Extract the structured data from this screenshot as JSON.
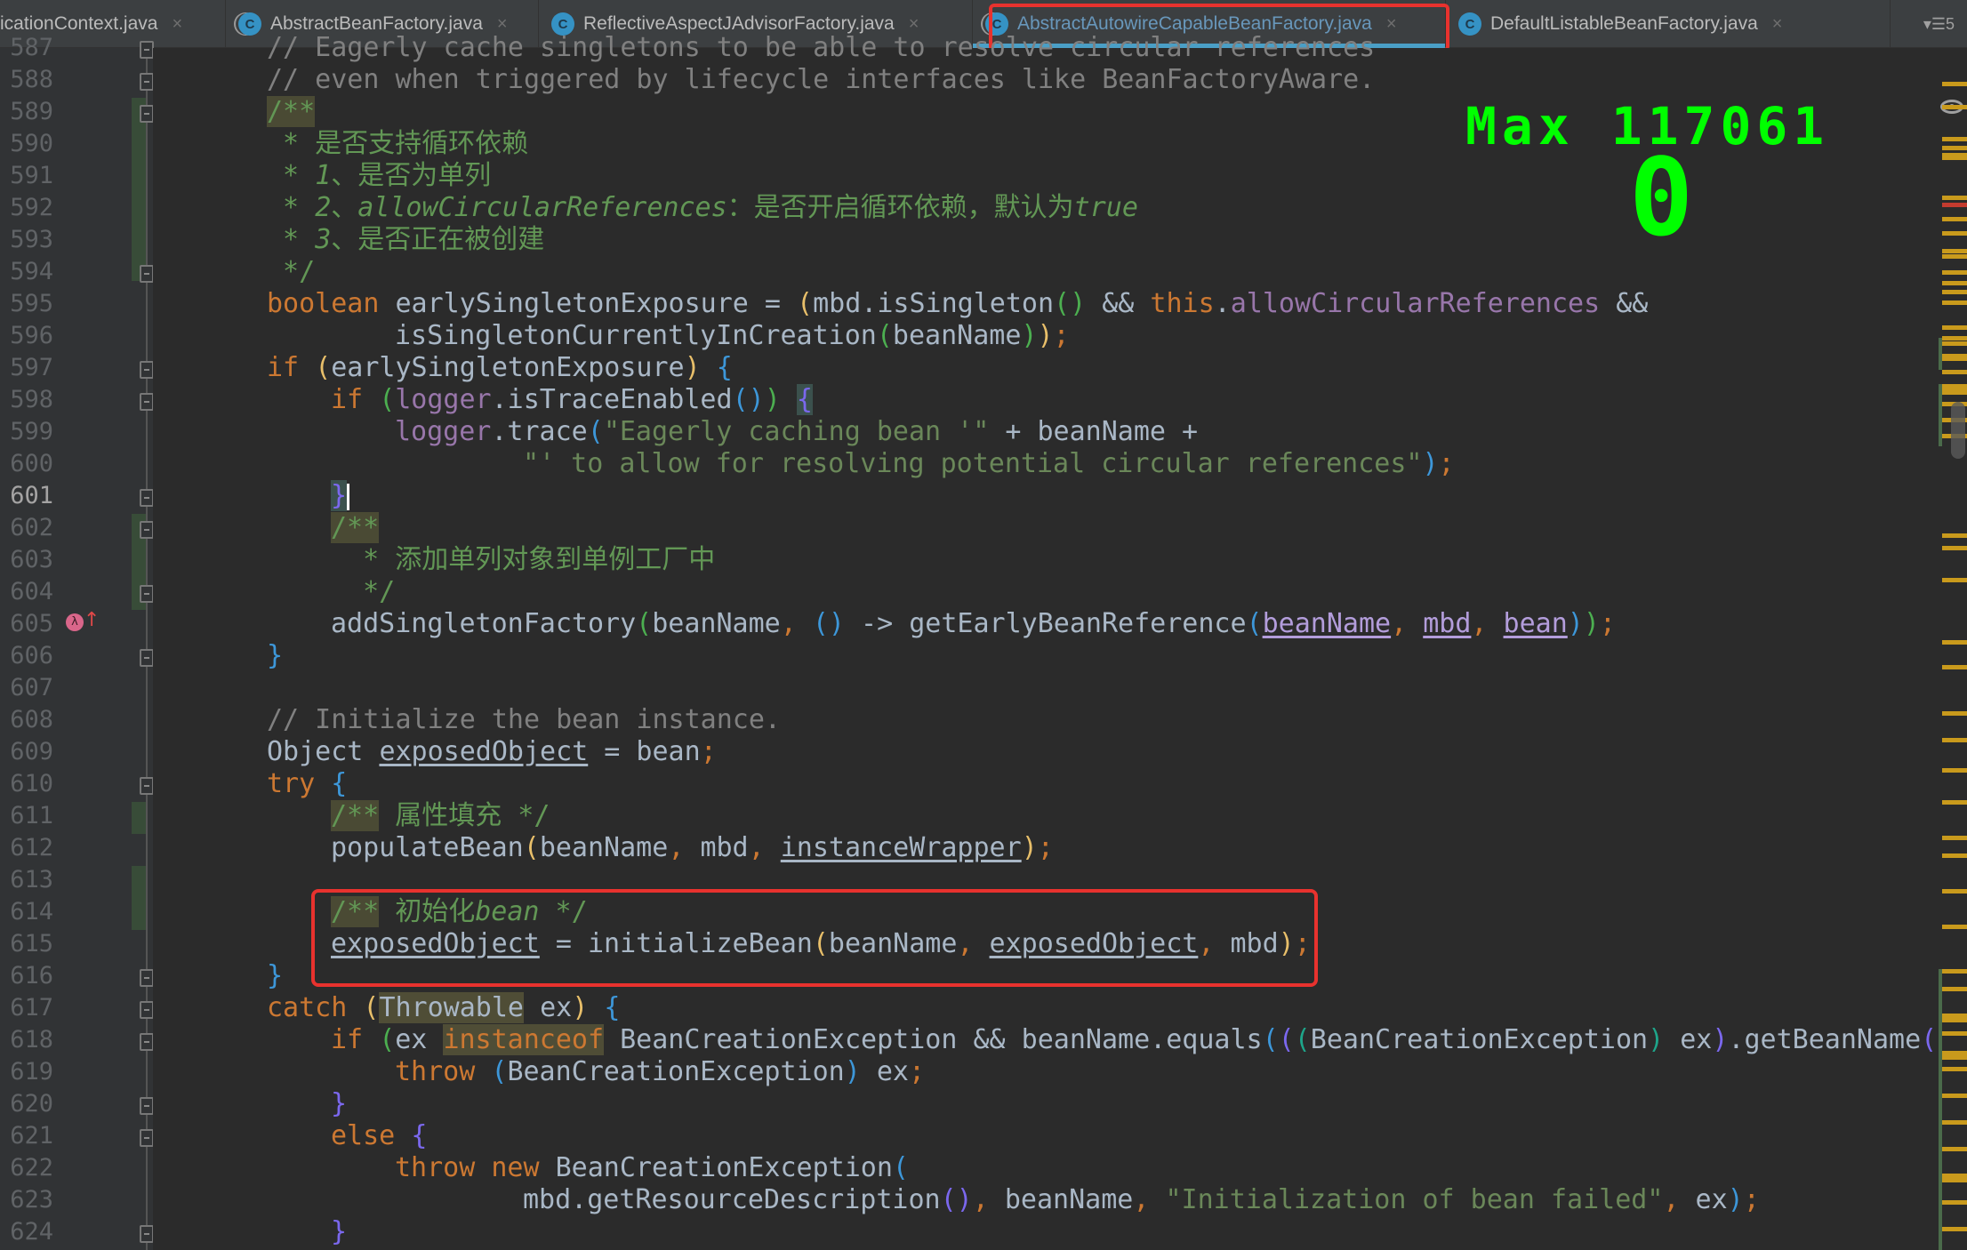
{
  "tabs": [
    {
      "label": "icationContext.java",
      "icon": "class-icon",
      "active": false
    },
    {
      "label": "AbstractBeanFactory.java",
      "icon": "abstract-class-icon",
      "active": false
    },
    {
      "label": "ReflectiveAspectJAdvisorFactory.java",
      "icon": "class-icon",
      "active": false
    },
    {
      "label": "AbstractAutowireCapableBeanFactory.java",
      "icon": "abstract-class-icon",
      "active": true
    },
    {
      "label": "DefaultListableBeanFactory.java",
      "icon": "class-icon",
      "active": false
    }
  ],
  "tab_close_glyph": "×",
  "tab_overflow": {
    "glyph": "▾☰",
    "count": "5"
  },
  "overlay": {
    "max_label": "Max",
    "max_value": "117061",
    "current_value": "0"
  },
  "editor": {
    "current_line": "601",
    "lines": [
      {
        "n": "587",
        "text": "// Eagerly cache singletons to be able to resolve circular references"
      },
      {
        "n": "588",
        "text": "// even when triggered by lifecycle interfaces like BeanFactoryAware."
      },
      {
        "n": "589",
        "text": "/**"
      },
      {
        "n": "590",
        "text": " * 是否支持循环依赖"
      },
      {
        "n": "591",
        "text": " * 1、是否为单列"
      },
      {
        "n": "592",
        "text": " * 2、allowCircularReferences：是否开启循环依赖，默认为true"
      },
      {
        "n": "593",
        "text": " * 3、是否正在被创建"
      },
      {
        "n": "594",
        "text": " */"
      },
      {
        "n": "595",
        "text": "boolean earlySingletonExposure = (mbd.isSingleton() && this.allowCircularReferences &&"
      },
      {
        "n": "596",
        "text": "        isSingletonCurrentlyInCreation(beanName));"
      },
      {
        "n": "597",
        "text": "if (earlySingletonExposure) {"
      },
      {
        "n": "598",
        "text": "    if (logger.isTraceEnabled()) {"
      },
      {
        "n": "599",
        "text": "        logger.trace(\"Eagerly caching bean '\" + beanName +"
      },
      {
        "n": "600",
        "text": "                \"' to allow for resolving potential circular references\");"
      },
      {
        "n": "601",
        "text": "    }"
      },
      {
        "n": "602",
        "text": "    /**"
      },
      {
        "n": "603",
        "text": "     * 添加单列对象到单例工厂中"
      },
      {
        "n": "604",
        "text": "     */"
      },
      {
        "n": "605",
        "text": "    addSingletonFactory(beanName, () -> getEarlyBeanReference(beanName, mbd, bean));"
      },
      {
        "n": "606",
        "text": "}"
      },
      {
        "n": "607",
        "text": ""
      },
      {
        "n": "608",
        "text": "// Initialize the bean instance."
      },
      {
        "n": "609",
        "text": "Object exposedObject = bean;"
      },
      {
        "n": "610",
        "text": "try {"
      },
      {
        "n": "611",
        "text": "    /** 属性填充 */"
      },
      {
        "n": "612",
        "text": "    populateBean(beanName, mbd, instanceWrapper);"
      },
      {
        "n": "613",
        "text": ""
      },
      {
        "n": "614",
        "text": "    /** 初始化bean */"
      },
      {
        "n": "615",
        "text": "    exposedObject = initializeBean(beanName, exposedObject, mbd);"
      },
      {
        "n": "616",
        "text": "}"
      },
      {
        "n": "617",
        "text": "catch (Throwable ex) {"
      },
      {
        "n": "618",
        "text": "    if (ex instanceof BeanCreationException && beanName.equals(((BeanCreationException) ex).getBeanName()))"
      },
      {
        "n": "619",
        "text": "        throw (BeanCreationException) ex;"
      },
      {
        "n": "620",
        "text": "    }"
      },
      {
        "n": "621",
        "text": "    else {"
      },
      {
        "n": "622",
        "text": "        throw new BeanCreationException("
      },
      {
        "n": "623",
        "text": "                mbd.getResourceDescription(), beanName, \"Initialization of bean failed\", ex);"
      },
      {
        "n": "624",
        "text": "    }"
      }
    ]
  },
  "tokens": {
    "l587": "// Eagerly cache singletons to be able to resolve circular references",
    "l588": "// even when triggered by lifecycle interfaces like BeanFactoryAware.",
    "doc_open": "/**",
    "l590": " * 是否支持循环依赖",
    "l591a": " * ",
    "l591b": "1",
    "l591c": "、是否为单列",
    "l592a": " * ",
    "l592b": "2",
    "l592c": "、",
    "l592d": "allowCircularReferences",
    "l592e": "：是否开启循环依赖，默认为",
    "l592f": "true",
    "l593a": " * ",
    "l593b": "3",
    "l593c": "、是否正在被创建",
    "doc_close": " */",
    "kw_boolean": "boolean",
    "kw_if": "if",
    "kw_this": "this",
    "kw_try": "try",
    "kw_catch": "catch",
    "kw_instanceof": "instanceof",
    "kw_throw": "throw",
    "kw_new": "new",
    "kw_else": "else",
    "v_esx": " earlySingletonExposure = ",
    "mbd_isSingleton": "mbd.isSingleton",
    "and": " && ",
    "dot": ".",
    "f_allow": "allowCircularReferences",
    "isSCIC": "isSingletonCurrentlyInCreation",
    "beanName": "beanName",
    "esx": "earlySingletonExposure",
    "logger": "logger",
    "isTraceEnabled": ".isTraceEnabled",
    "trace": ".trace",
    "str1": "\"Eagerly caching bean '\"",
    "plus_bn": " + beanName +",
    "str2": "\"' to allow for resolving potential circular references\"",
    "l603": "  * 添加单列对象到单例工厂中",
    "l604": "  */",
    "addSF": "addSingletonFactory",
    "arrow": " -> getEarlyBeanReference",
    "mbd": "mbd",
    "bean": "bean",
    "l608": "// Initialize the bean instance.",
    "Object": "Object ",
    "exposedObject": "exposedObject",
    "eq_bean": " = bean",
    "doc611a": "/**",
    "doc611b": " 属性填充 */",
    "populateBean": "populateBean",
    "instanceWrapper": "instanceWrapper",
    "doc614a": "/**",
    "doc614b": " 初始化",
    "doc614c": "bean",
    "doc614d": " */",
    "eq_init": " = initializeBean",
    "Throwable": "Throwable",
    "ex": "ex",
    "BCE": "BeanCreationException",
    "beanName_equals": " && beanName.equals",
    "getBeanName": ".getBeanName",
    "getResDesc": "mbd.getResourceDescription",
    "str3": "\"Initialization of bean failed\"",
    "comma": ", ",
    "semi": ";",
    "lp": "(",
    "rp": ")",
    "lb": "{",
    "rb": "}"
  },
  "colors": {
    "keyword": "#cc7832",
    "comment": "#808080",
    "doc_comment": "#629755",
    "string": "#6a8759",
    "field": "#9876aa",
    "text": "#a9b7c6",
    "highlight_box": "#e8322e",
    "overlay_text": "#00ff00",
    "active_tab_underline": "#4a9fc6"
  }
}
